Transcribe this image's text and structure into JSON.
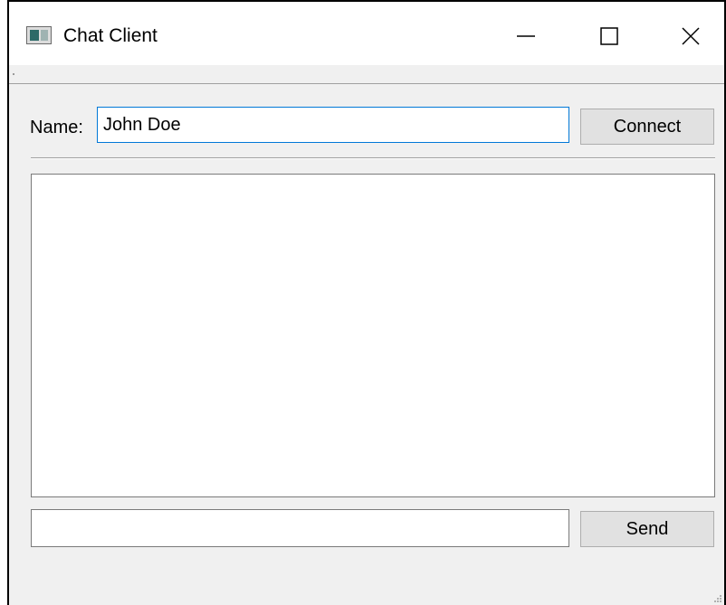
{
  "window": {
    "title": "Chat Client",
    "controls": {
      "minimize_icon": "minimize-icon",
      "maximize_icon": "maximize-icon",
      "close_icon": "close-icon"
    }
  },
  "connection": {
    "name_label": "Name:",
    "name_value": "John Doe",
    "connect_label": "Connect"
  },
  "chat": {
    "messages": [],
    "message_value": "",
    "send_label": "Send"
  },
  "colors": {
    "focus_border": "#0078d7",
    "window_bg": "#f0f0f0",
    "button_bg": "#e1e1e1"
  }
}
